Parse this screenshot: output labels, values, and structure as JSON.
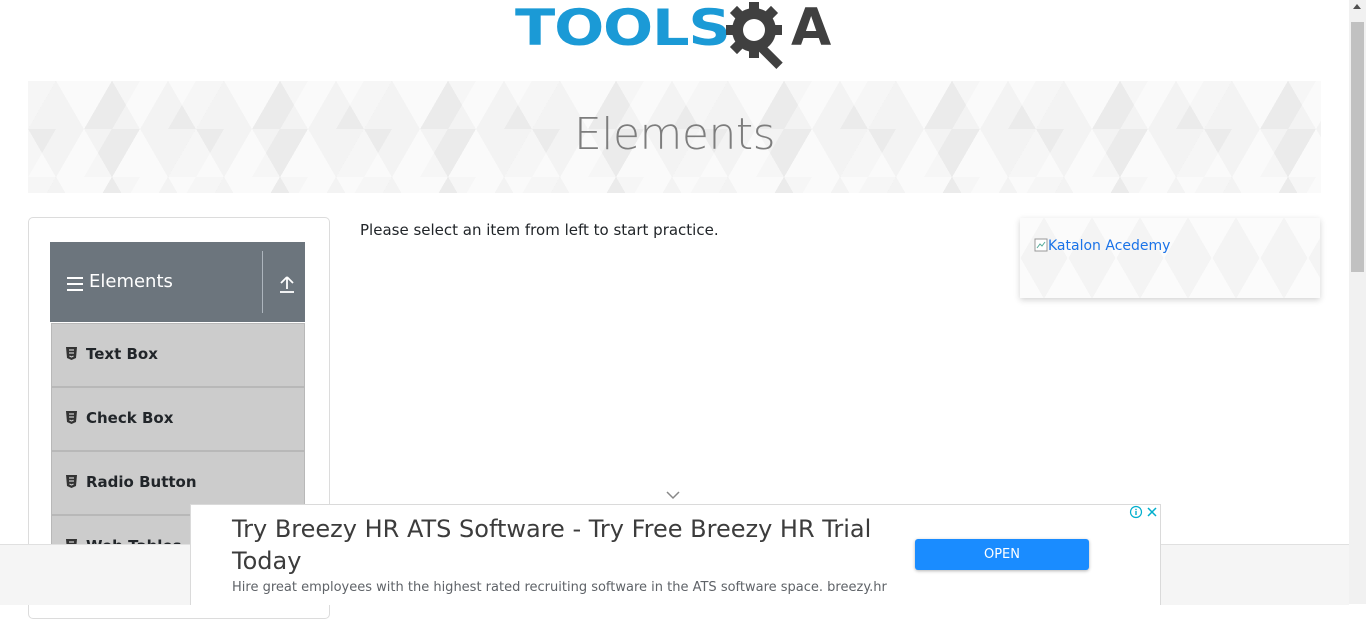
{
  "header": {
    "logo_text": "TOOLS",
    "logo_suffix": "A"
  },
  "banner": {
    "title": "Elements"
  },
  "sidebar": {
    "group_title": "Elements",
    "items": [
      {
        "label": "Text Box"
      },
      {
        "label": "Check Box"
      },
      {
        "label": "Radio Button"
      },
      {
        "label": "Web Tables"
      }
    ]
  },
  "main": {
    "instruction": "Please select an item from left to start practice."
  },
  "side_ad": {
    "alt_text": "Katalon Acedemy"
  },
  "bottom_ad": {
    "title": "Try Breezy HR ATS Software - Try Free Breezy HR Trial Today",
    "description": "Hire great employees with the highest rated recruiting software in the ATS software space. breezy.hr",
    "button_label": "OPEN"
  },
  "colors": {
    "logo_blue": "#1b9ad6",
    "logo_dark": "#404040",
    "group_header_bg": "#6c757d",
    "menu_item_bg": "#cccccc",
    "ad_button_bg": "#1a8cff"
  }
}
